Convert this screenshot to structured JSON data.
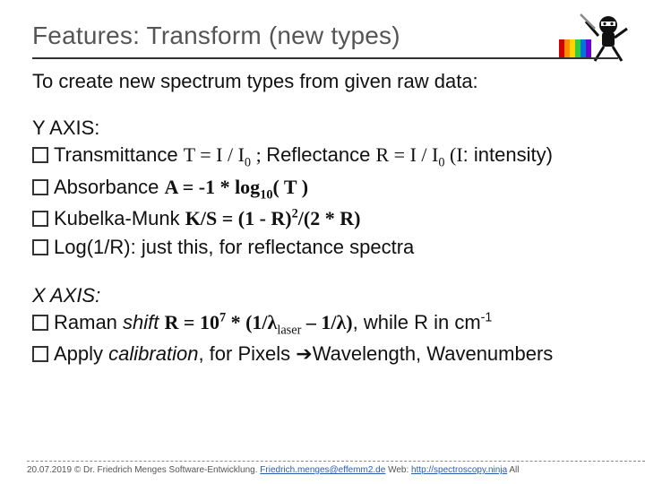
{
  "title": "Features: Transform (new types)",
  "intro": "To create new spectrum types from given raw data:",
  "y_axis": {
    "label": "Y AXIS:",
    "items": {
      "transmittance": {
        "prefix": "Transmittance ",
        "formula_lead": "T = I / I",
        "sub0_a": "0",
        "sep": " ; ",
        "reflect_label": "Reflectance ",
        "reflect_formula": "R = I / I",
        "sub0_b": "0",
        "paren_open": " (I",
        "intensity_tail": ": intensity)"
      },
      "absorbance": {
        "prefix": "Absorbance ",
        "formula_a": "A = -1 * log",
        "sub10": "10",
        "formula_b": "( T )"
      },
      "km": {
        "prefix": "Kubelka-Munk ",
        "formula_a": "K/S = (1 - R)",
        "sup2": "2",
        "formula_b": "/(2 * R)"
      },
      "logr": {
        "prefix": "Log(1/R)",
        "tail": ": just this, for reflectance spectra"
      }
    }
  },
  "x_axis": {
    "label": "X AXIS:",
    "items": {
      "raman": {
        "prefix": "Raman ",
        "shift_word": "shift ",
        "formula_a": "R = 10",
        "sup7": "7",
        "formula_b": " * (1/λ",
        "sub_laser": "laser",
        "formula_c": " – 1/λ)",
        "tail_a": ", while R in cm",
        "sup_neg1": "-1"
      },
      "apply": {
        "prefix": "Apply ",
        "calib": "calibration",
        "arrow_text_a": ", for Pixels ",
        "arrow": "➔",
        "wavelength": "Wavelength, Wavenumbers"
      }
    }
  },
  "footer": {
    "left": "20.07.2019   © Dr. Friedrich Menges Software-Entwicklung. ",
    "email": "Friedrich.menges@effemm2.de",
    "web_label": "  Web:  ",
    "web_url": "http://spectroscopy.ninja",
    "tail": "   All"
  }
}
